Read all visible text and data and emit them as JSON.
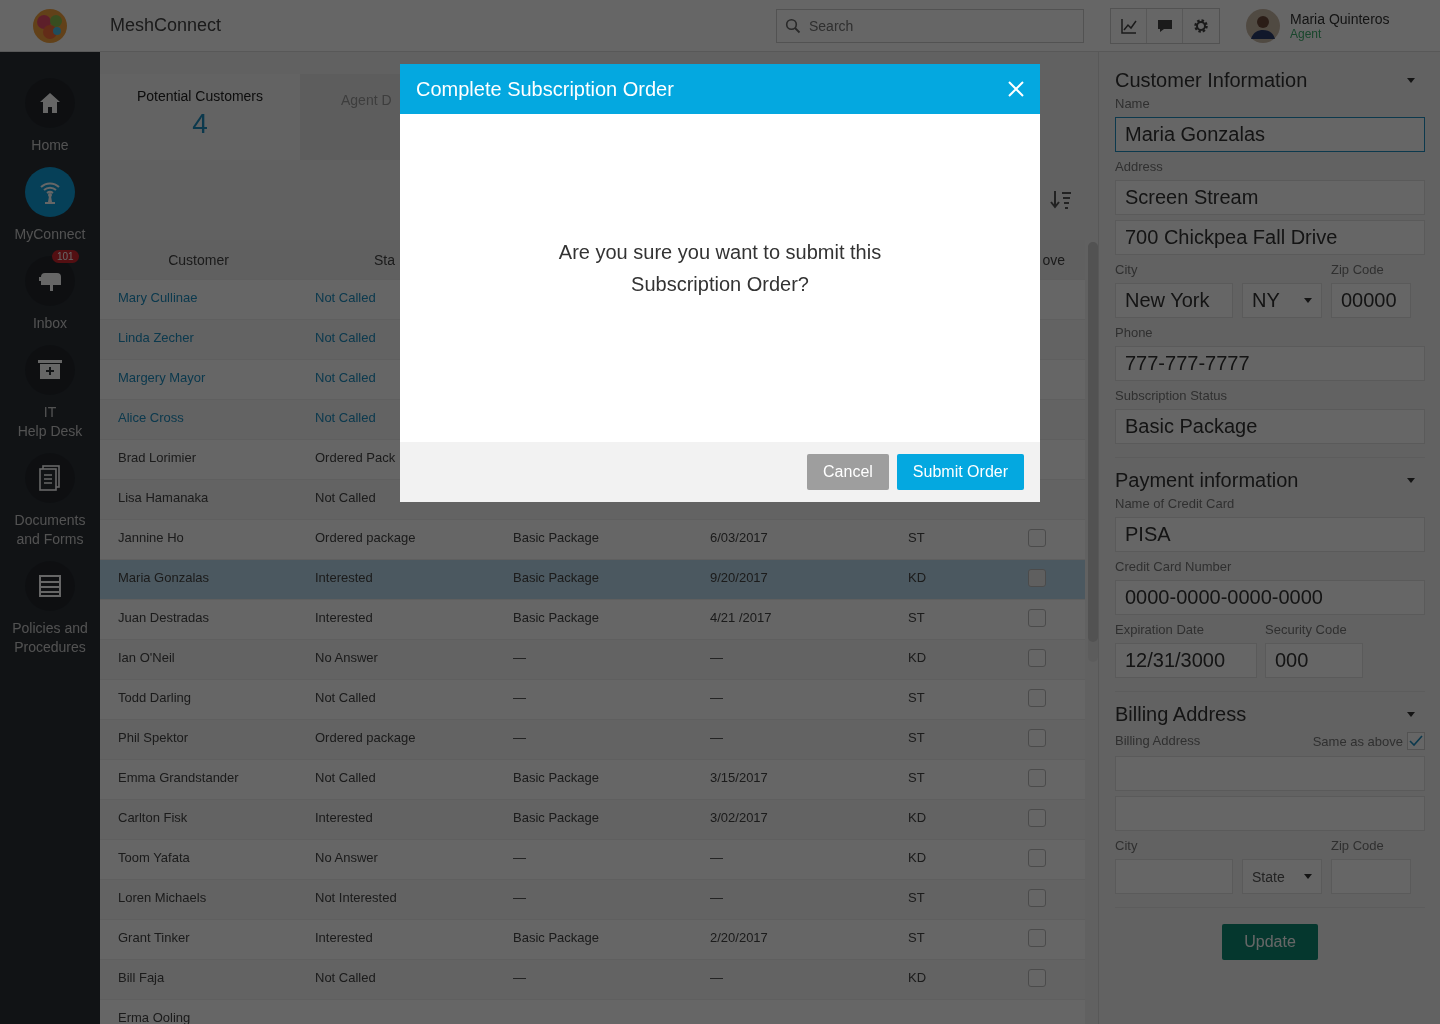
{
  "top_bar": {
    "app_name": "MeshConnect",
    "search": {
      "placeholder": "Search"
    },
    "user": {
      "name": "Maria Quinteros",
      "role": "Agent"
    }
  },
  "nav": [
    {
      "label": "Home",
      "kind": "home",
      "selected": false
    },
    {
      "label": "MyConnect",
      "kind": "antenna",
      "selected": true
    },
    {
      "label": "Inbox",
      "kind": "mailbox",
      "selected": false,
      "badge": "101"
    },
    {
      "label": "IT\nHelp Desk",
      "kind": "medkit",
      "selected": false
    },
    {
      "label": "Documents and Forms",
      "kind": "document",
      "selected": false
    },
    {
      "label": "Policies and Procedures",
      "kind": "stack",
      "selected": false
    }
  ],
  "tabs": [
    {
      "label": "Potential Customers",
      "count": "4",
      "selected": true
    },
    {
      "label": "Agent D",
      "selected": false
    }
  ],
  "table": {
    "columns": [
      "Customer",
      "Sta",
      null,
      null,
      null,
      "ove"
    ],
    "rows": [
      {
        "cells": [
          "Mary Cullinae",
          "Not Called",
          null,
          null,
          null
        ],
        "highlighted": true,
        "selected": false
      },
      {
        "cells": [
          "Linda Zecher",
          "Not Called",
          null,
          null,
          null
        ],
        "highlighted": true,
        "selected": false
      },
      {
        "cells": [
          "Margery Mayor",
          "Not Called",
          null,
          null,
          null
        ],
        "highlighted": true,
        "selected": false
      },
      {
        "cells": [
          "Alice Cross",
          "Not Called",
          null,
          null,
          null
        ],
        "highlighted": true,
        "selected": false
      },
      {
        "cells": [
          "Brad Lorimier",
          "Ordered Pack",
          null,
          null,
          null
        ],
        "highlighted": false,
        "selected": false
      },
      {
        "cells": [
          "Lisa Hamanaka",
          "Not Called",
          null,
          null,
          null
        ],
        "highlighted": false,
        "selected": false
      },
      {
        "cells": [
          "Jannine Ho",
          "Ordered package",
          "Basic Package",
          "6/03/2017",
          "ST"
        ],
        "highlighted": false,
        "selected": false,
        "checked": false
      },
      {
        "cells": [
          "Maria Gonzalas",
          "Interested",
          "Basic Package",
          "9/20/2017",
          "KD"
        ],
        "highlighted": false,
        "selected": true,
        "checked": false
      },
      {
        "cells": [
          "Juan Destradas",
          "Interested",
          "Basic Package",
          "4/21 /2017",
          "ST"
        ],
        "highlighted": false,
        "selected": false,
        "checked": false
      },
      {
        "cells": [
          "Ian O'Neil",
          "No Answer",
          "—",
          "—",
          "KD"
        ],
        "highlighted": false,
        "selected": false,
        "checked": false
      },
      {
        "cells": [
          "Todd Darling",
          "Not Called",
          "—",
          "—",
          "ST"
        ],
        "highlighted": false,
        "selected": false,
        "checked": false
      },
      {
        "cells": [
          "Phil Spektor",
          "Ordered package",
          "—",
          "—",
          "ST"
        ],
        "highlighted": false,
        "selected": false,
        "checked": false
      },
      {
        "cells": [
          "Emma Grandstander",
          "Not Called",
          "Basic Package",
          "3/15/2017",
          "ST"
        ],
        "highlighted": false,
        "selected": false,
        "checked": false
      },
      {
        "cells": [
          "Carlton Fisk",
          "Interested",
          "Basic Package",
          "3/02/2017",
          "KD"
        ],
        "highlighted": false,
        "selected": false,
        "checked": false
      },
      {
        "cells": [
          "Toom Yafata",
          "No Answer",
          "—",
          "—",
          "KD"
        ],
        "highlighted": false,
        "selected": false,
        "checked": false
      },
      {
        "cells": [
          "Loren Michaels",
          "Not Interested",
          "—",
          "—",
          "ST"
        ],
        "highlighted": false,
        "selected": false,
        "checked": false
      },
      {
        "cells": [
          "Grant Tinker",
          "Interested",
          "Basic Package",
          "2/20/2017",
          "ST"
        ],
        "highlighted": false,
        "selected": false,
        "checked": false
      },
      {
        "cells": [
          "Bill Faja",
          "Not Called",
          "—",
          "—",
          "KD"
        ],
        "highlighted": false,
        "selected": false,
        "checked": false
      },
      {
        "cells": [
          "Erma Ooling",
          null,
          null,
          null,
          null
        ],
        "highlighted": false,
        "selected": false
      }
    ]
  },
  "details": {
    "sections": [
      {
        "title": "Customer Information",
        "expanded": true,
        "rows": [
          {
            "kind": "full",
            "fields": [
              {
                "label": "Name",
                "value": "Maria Gonzalas",
                "focused": true
              }
            ]
          },
          {
            "kind": "full",
            "fields": [
              {
                "label": "Address",
                "value": "Screen Stream",
                "focused": false
              }
            ]
          },
          {
            "kind": "full",
            "fields": [
              {
                "value": "700 Chickpea Fall Drive",
                "focused": false
              }
            ]
          },
          {
            "kind": "city",
            "fields": [
              {
                "label": "City",
                "value": "New York",
                "focused": false
              },
              {
                "value": "NY",
                "kind": "select",
                "focused": false
              },
              {
                "label": "Zip Code",
                "value": "00000",
                "focused": false
              }
            ]
          },
          {
            "kind": "full",
            "fields": [
              {
                "label": "Phone",
                "value": "777-777-7777",
                "focused": false
              }
            ]
          },
          {
            "kind": "full",
            "fields": [
              {
                "label": "Subscription Status",
                "value": "Basic Package",
                "focused": false
              }
            ]
          }
        ]
      },
      {
        "title": "Payment information",
        "expanded": true,
        "rows": [
          {
            "kind": "full",
            "fields": [
              {
                "label": "Name of Credit Card",
                "value": "PISA",
                "focused": false
              }
            ]
          },
          {
            "kind": "full",
            "fields": [
              {
                "label": "Credit Card Number",
                "value": "0000-0000-0000-0000",
                "focused": false
              }
            ]
          },
          {
            "kind": "expiry",
            "fields": [
              {
                "label": "Expiration Date",
                "value": "12/31/3000",
                "focused": false
              },
              {
                "label": "Security Code",
                "value": "000",
                "focused": false
              }
            ]
          }
        ]
      },
      {
        "title": "Billing Address",
        "expanded": true,
        "rows": [
          {
            "kind": "check",
            "label": "Billing Address",
            "check_label": "Same as above",
            "checked": true
          },
          {
            "kind": "full",
            "fields": [
              {
                "focused": false
              }
            ]
          },
          {
            "kind": "full",
            "fields": [
              {
                "focused": false
              }
            ]
          },
          {
            "kind": "city",
            "fields": [
              {
                "label": "City",
                "focused": false
              },
              {
                "kind": "select",
                "placeholder": "State",
                "focused": false
              },
              {
                "label": "Zip Code",
                "focused": false
              }
            ]
          }
        ]
      }
    ],
    "button": "Update"
  },
  "dialog": {
    "title": "Complete Subscription Order",
    "message": "Are you sure you want to submit this Subscription Order?",
    "buttons": [
      {
        "label": "Cancel",
        "kind": "secondary"
      },
      {
        "label": "Submit Order",
        "kind": "primary"
      }
    ]
  }
}
